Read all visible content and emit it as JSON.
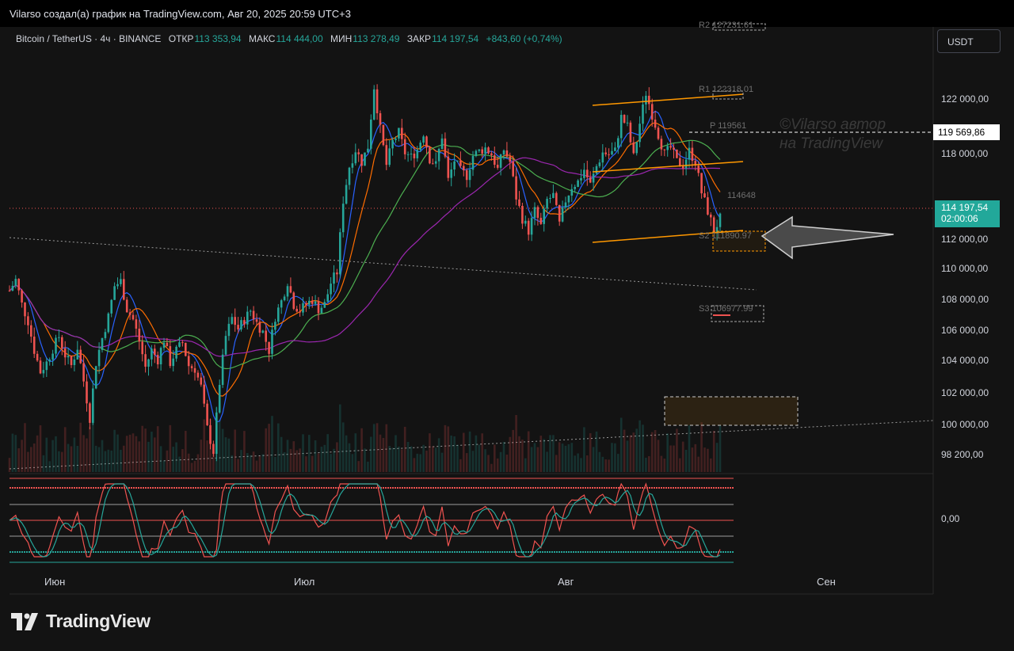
{
  "header": {
    "title": "Vilarso создал(а) график на TradingView.com, Авг 20, 2025 20:59 UTC+3"
  },
  "symbol_line": {
    "symbol": "Bitcoin / TetherUS · 4ч · BINANCE",
    "open_label": "ОТКР",
    "open": "113 353,94",
    "high_label": "МАКС",
    "high": "114 444,00",
    "low_label": "МИН",
    "low": "113 278,49",
    "close_label": "ЗАКР",
    "close": "114 197,54",
    "change": "+843,60 (+0,74%)"
  },
  "currency_button": "USDT",
  "watermark": {
    "line1": "©Vilarso автор",
    "line2": "на TradingView"
  },
  "price_scale": {
    "labels": [
      "122 000,00",
      "118 000,00",
      "112 000,00",
      "110 000,00",
      "108 000,00",
      "106 000,00",
      "104 000,00",
      "102 000,00",
      "100 000,00",
      "98 200,00"
    ],
    "pivot_value": "119 569,86",
    "last_price": "114 197,54",
    "countdown": "02:00:06"
  },
  "oscillator": {
    "zero_label": "0,00"
  },
  "time_axis": {
    "labels": [
      "Июн",
      "Июл",
      "Авг",
      "Сен"
    ]
  },
  "pivots": {
    "r2": "R2 127231.61",
    "r1": "R1 122318.01",
    "p": "P 119561",
    "s1": "114648",
    "s2": "S2 111890.97",
    "s3": "S3 106977.99"
  },
  "footer": {
    "brand": "TradingView"
  },
  "colors": {
    "up": "#26a69a",
    "down": "#ef5350",
    "ma_fast": "#2962ff",
    "ma_mid": "#ff6d00",
    "ma_slow": "#4caf50",
    "ma_long": "#9c27b0",
    "trend_channel": "#ff9800",
    "last_price_bg": "#22a89a"
  },
  "chart_data": {
    "type": "candlestick",
    "title": "Bitcoin / TetherUS · 4ч · BINANCE",
    "ylim": [
      98000,
      124000
    ],
    "x_ticks": [
      "Июн",
      "Июл",
      "Авг",
      "Сен"
    ],
    "y_ticks": [
      98200,
      100000,
      102000,
      104000,
      106000,
      108000,
      110000,
      112000,
      118000,
      122000
    ],
    "last_close": 114197.54,
    "pivot_levels": {
      "R2": 127231.61,
      "R1": 122318.01,
      "P": 119561,
      "S1": 114648,
      "S2": 111890.97,
      "S3": 106977.99
    },
    "price_path": [
      [
        0,
        109500
      ],
      [
        2,
        110200
      ],
      [
        4,
        108600
      ],
      [
        6,
        107500
      ],
      [
        8,
        105600
      ],
      [
        10,
        104200
      ],
      [
        12,
        104800
      ],
      [
        14,
        105700
      ],
      [
        16,
        106500
      ],
      [
        18,
        105300
      ],
      [
        20,
        104600
      ],
      [
        22,
        105800
      ],
      [
        24,
        103600
      ],
      [
        26,
        101200
      ],
      [
        28,
        104800
      ],
      [
        30,
        106400
      ],
      [
        32,
        107800
      ],
      [
        34,
        109800
      ],
      [
        36,
        110100
      ],
      [
        38,
        108300
      ],
      [
        40,
        107600
      ],
      [
        42,
        106200
      ],
      [
        44,
        104500
      ],
      [
        46,
        105600
      ],
      [
        48,
        105000
      ],
      [
        50,
        106300
      ],
      [
        52,
        104800
      ],
      [
        54,
        105600
      ],
      [
        56,
        106100
      ],
      [
        58,
        104600
      ],
      [
        60,
        104400
      ],
      [
        62,
        103200
      ],
      [
        64,
        100500
      ],
      [
        66,
        99000
      ],
      [
        68,
        103500
      ],
      [
        70,
        106500
      ],
      [
        72,
        107700
      ],
      [
        74,
        107000
      ],
      [
        76,
        107600
      ],
      [
        78,
        108200
      ],
      [
        80,
        107400
      ],
      [
        82,
        106800
      ],
      [
        84,
        105600
      ],
      [
        86,
        107800
      ],
      [
        88,
        108800
      ],
      [
        90,
        110100
      ],
      [
        92,
        108600
      ],
      [
        94,
        108200
      ],
      [
        96,
        108600
      ],
      [
        98,
        108900
      ],
      [
        100,
        108300
      ],
      [
        102,
        108600
      ],
      [
        104,
        110000
      ],
      [
        106,
        110700
      ],
      [
        108,
        115400
      ],
      [
        110,
        117600
      ],
      [
        112,
        118700
      ],
      [
        114,
        117900
      ],
      [
        116,
        118900
      ],
      [
        118,
        122800
      ],
      [
        120,
        120000
      ],
      [
        122,
        117700
      ],
      [
        124,
        119200
      ],
      [
        126,
        119800
      ],
      [
        128,
        118500
      ],
      [
        130,
        118200
      ],
      [
        132,
        118700
      ],
      [
        134,
        119800
      ],
      [
        136,
        118100
      ],
      [
        138,
        117700
      ],
      [
        140,
        119600
      ],
      [
        142,
        116700
      ],
      [
        144,
        118000
      ],
      [
        146,
        117300
      ],
      [
        148,
        117000
      ],
      [
        150,
        118300
      ],
      [
        152,
        118600
      ],
      [
        154,
        118800
      ],
      [
        156,
        118400
      ],
      [
        158,
        117400
      ],
      [
        160,
        118700
      ],
      [
        162,
        117900
      ],
      [
        164,
        115600
      ],
      [
        166,
        114200
      ],
      [
        168,
        113400
      ],
      [
        170,
        114700
      ],
      [
        172,
        113700
      ],
      [
        174,
        115400
      ],
      [
        176,
        115700
      ],
      [
        178,
        113800
      ],
      [
        180,
        115400
      ],
      [
        182,
        116300
      ],
      [
        184,
        116600
      ],
      [
        186,
        117400
      ],
      [
        188,
        116400
      ],
      [
        190,
        117600
      ],
      [
        192,
        118500
      ],
      [
        194,
        118400
      ],
      [
        196,
        118600
      ],
      [
        198,
        120800
      ],
      [
        200,
        120200
      ],
      [
        202,
        118200
      ],
      [
        204,
        120400
      ],
      [
        206,
        122400
      ],
      [
        208,
        121000
      ],
      [
        210,
        119700
      ],
      [
        212,
        118400
      ],
      [
        214,
        118800
      ],
      [
        216,
        117900
      ],
      [
        218,
        117700
      ],
      [
        220,
        118600
      ],
      [
        222,
        117900
      ],
      [
        224,
        115900
      ],
      [
        226,
        114700
      ],
      [
        228,
        113400
      ],
      [
        230,
        114200
      ]
    ]
  }
}
